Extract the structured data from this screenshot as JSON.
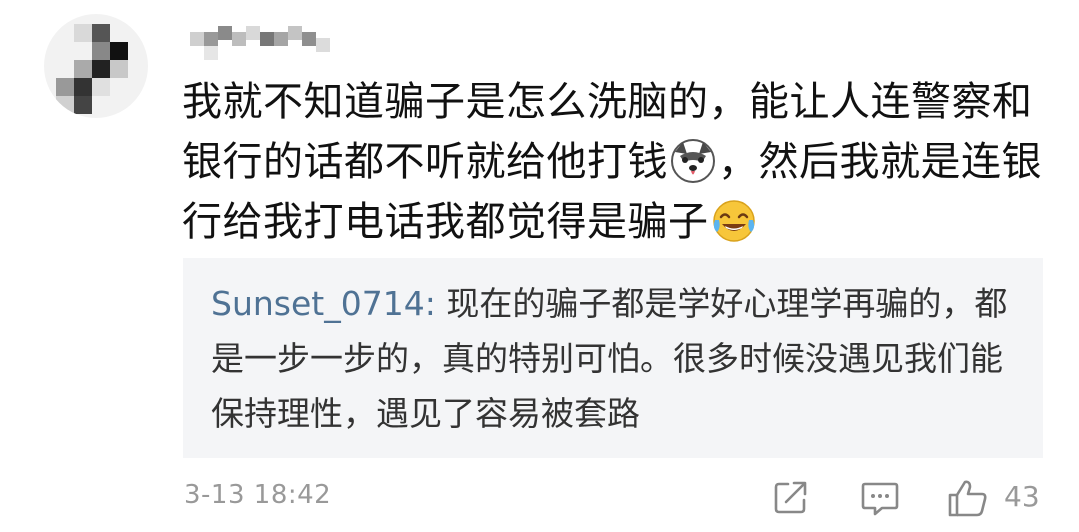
{
  "comment": {
    "text_1": "我就不知道骗子是怎么洗脑的，能让人连警察和银行的话都不听就给他打钱",
    "text_2": "，然后我就是连银行给我打电话我都觉得是骗子",
    "emoji_1": "husky-emoji",
    "emoji_2": "laughing-crying-emoji"
  },
  "reply": {
    "author": "Sunset_0714",
    "colon": ": ",
    "text": "现在的骗子都是学好心理学再骗的，都是一步一步的，真的特别可怕。很多时候没遇见我们能保持理性，遇见了容易被套路"
  },
  "footer": {
    "timestamp": "3-13 18:42",
    "like_count": "43",
    "icons": [
      "share-icon",
      "comment-icon",
      "like-icon"
    ]
  },
  "colors": {
    "reply_author": "#4f7294",
    "reply_background": "#f4f5f7",
    "meta_text": "#999999"
  }
}
